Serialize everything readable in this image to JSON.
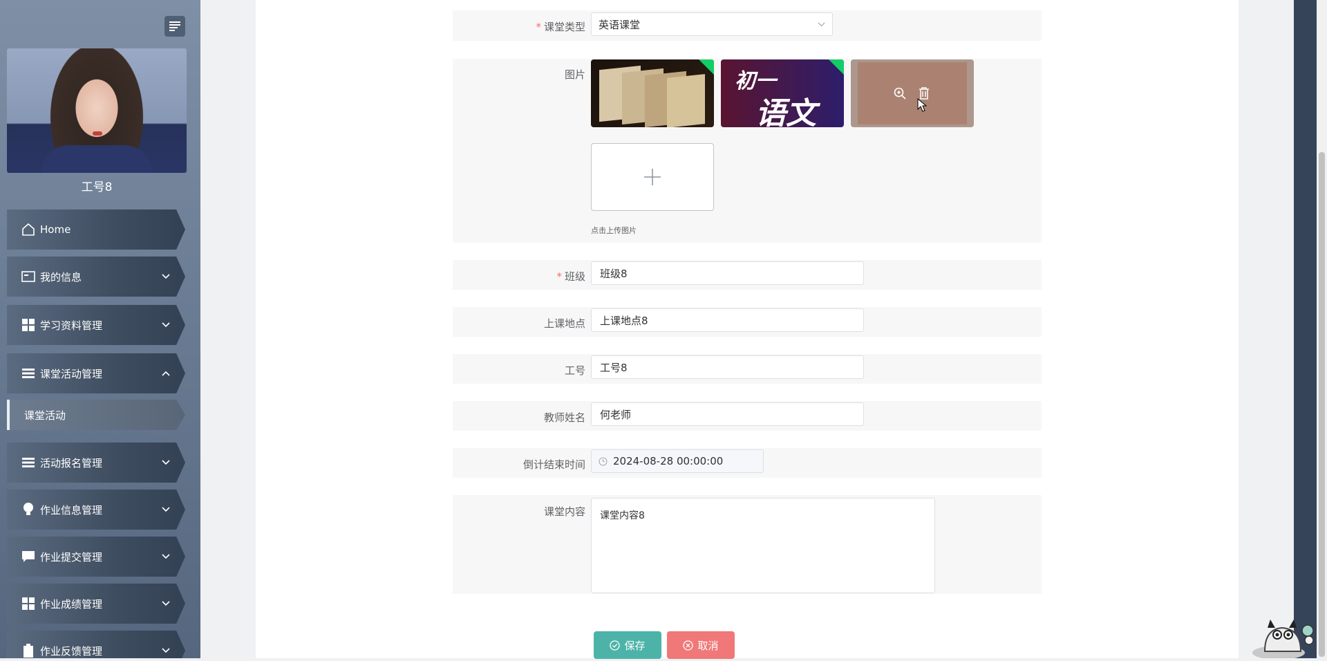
{
  "sidebar": {
    "user_name": "工号8",
    "menu": [
      {
        "label": "Home",
        "icon": "home-icon"
      },
      {
        "label": "我的信息",
        "icon": "id-card-icon"
      },
      {
        "label": "学习资料管理",
        "icon": "grid-icon"
      },
      {
        "label": "课堂活动管理",
        "icon": "list-icon"
      },
      {
        "label": "活动报名管理",
        "icon": "list-icon"
      },
      {
        "label": "作业信息管理",
        "icon": "bulb-icon"
      },
      {
        "label": "作业提交管理",
        "icon": "chat-icon"
      },
      {
        "label": "作业成绩管理",
        "icon": "grid-icon"
      },
      {
        "label": "作业反馈管理",
        "icon": "clipboard-icon"
      }
    ],
    "submenu": [
      {
        "label": "课堂活动"
      }
    ]
  },
  "form": {
    "class_type": {
      "label": "课堂类型",
      "value": "英语课堂"
    },
    "images": {
      "label": "图片",
      "hint": "点击上传图片"
    },
    "class_group": {
      "label": "班级",
      "value": "班级8"
    },
    "location": {
      "label": "上课地点",
      "value": "上课地点8"
    },
    "employee_id": {
      "label": "工号",
      "value": "工号8"
    },
    "teacher_name": {
      "label": "教师姓名",
      "value": "何老师"
    },
    "countdown_end": {
      "label": "倒计结束时间",
      "value": "2024-08-28 00:00:00"
    },
    "content": {
      "label": "课堂内容",
      "value": "课堂内容8"
    },
    "thumb2_text": {
      "line1": "初一",
      "line2": "语文"
    }
  },
  "actions": {
    "save": "保存",
    "cancel": "取消"
  },
  "colors": {
    "save": "#4db3a8",
    "cancel": "#f07878",
    "required": "#f56c6c"
  }
}
